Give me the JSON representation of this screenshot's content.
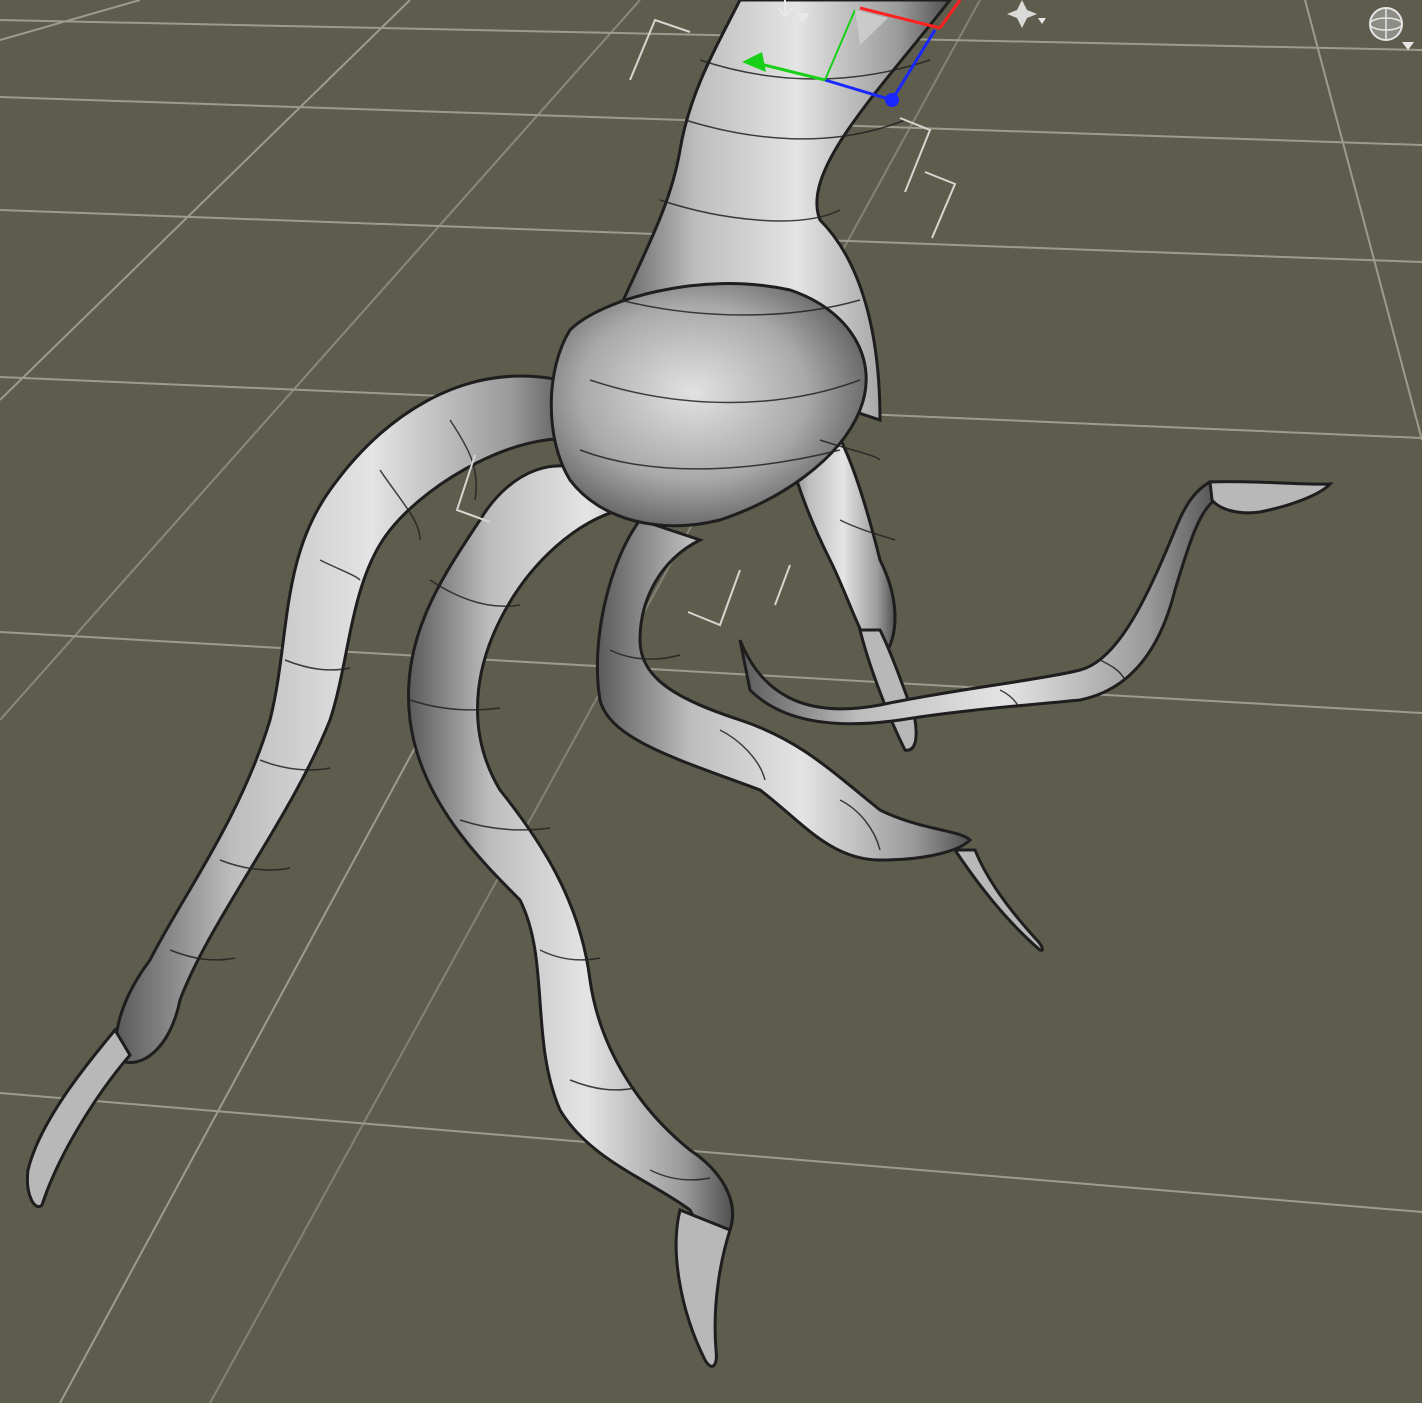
{
  "viewport": {
    "background": "#5d5c4d",
    "grid_color": "#a8a79a",
    "mesh_fill": "#a4a4a4",
    "mesh_wire": "#222222"
  },
  "toolbar": {
    "move_tool_icon": "move-arrows-icon",
    "light_tool_icon": "light-sparkle-icon",
    "camera_sphere_icon": "sphere-icon"
  },
  "gizmo": {
    "x_axis_color": "#ff2020",
    "y_axis_color": "#18d018",
    "z_axis_color": "#1a28ff"
  },
  "object": {
    "kind": "tree-root-mesh",
    "selected": true
  }
}
